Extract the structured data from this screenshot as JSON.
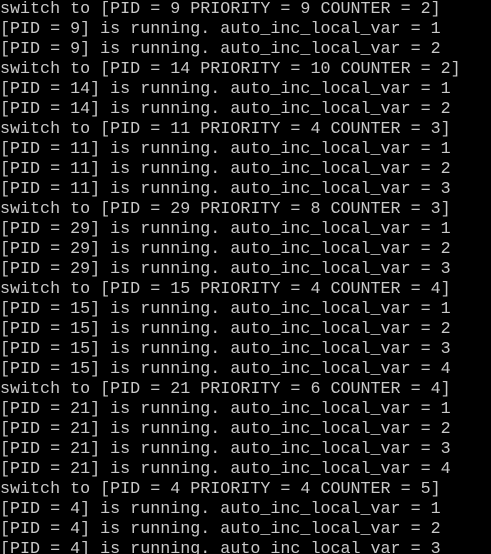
{
  "terminal": {
    "background": "#000000",
    "foreground": "#c8c8c8",
    "lines": [
      "switch to [PID = 9 PRIORITY = 9 COUNTER = 2]",
      "[PID = 9] is running. auto_inc_local_var = 1",
      "[PID = 9] is running. auto_inc_local_var = 2",
      "switch to [PID = 14 PRIORITY = 10 COUNTER = 2]",
      "[PID = 14] is running. auto_inc_local_var = 1",
      "[PID = 14] is running. auto_inc_local_var = 2",
      "switch to [PID = 11 PRIORITY = 4 COUNTER = 3]",
      "[PID = 11] is running. auto_inc_local_var = 1",
      "[PID = 11] is running. auto_inc_local_var = 2",
      "[PID = 11] is running. auto_inc_local_var = 3",
      "switch to [PID = 29 PRIORITY = 8 COUNTER = 3]",
      "[PID = 29] is running. auto_inc_local_var = 1",
      "[PID = 29] is running. auto_inc_local_var = 2",
      "[PID = 29] is running. auto_inc_local_var = 3",
      "switch to [PID = 15 PRIORITY = 4 COUNTER = 4]",
      "[PID = 15] is running. auto_inc_local_var = 1",
      "[PID = 15] is running. auto_inc_local_var = 2",
      "[PID = 15] is running. auto_inc_local_var = 3",
      "[PID = 15] is running. auto_inc_local_var = 4",
      "switch to [PID = 21 PRIORITY = 6 COUNTER = 4]",
      "[PID = 21] is running. auto_inc_local_var = 1",
      "[PID = 21] is running. auto_inc_local_var = 2",
      "[PID = 21] is running. auto_inc_local_var = 3",
      "[PID = 21] is running. auto_inc_local_var = 4",
      "switch to [PID = 4 PRIORITY = 4 COUNTER = 5]",
      "[PID = 4] is running. auto_inc_local_var = 1",
      "[PID = 4] is running. auto_inc_local_var = 2",
      "[PID = 4] is running. auto_inc_local_var = 3"
    ]
  }
}
